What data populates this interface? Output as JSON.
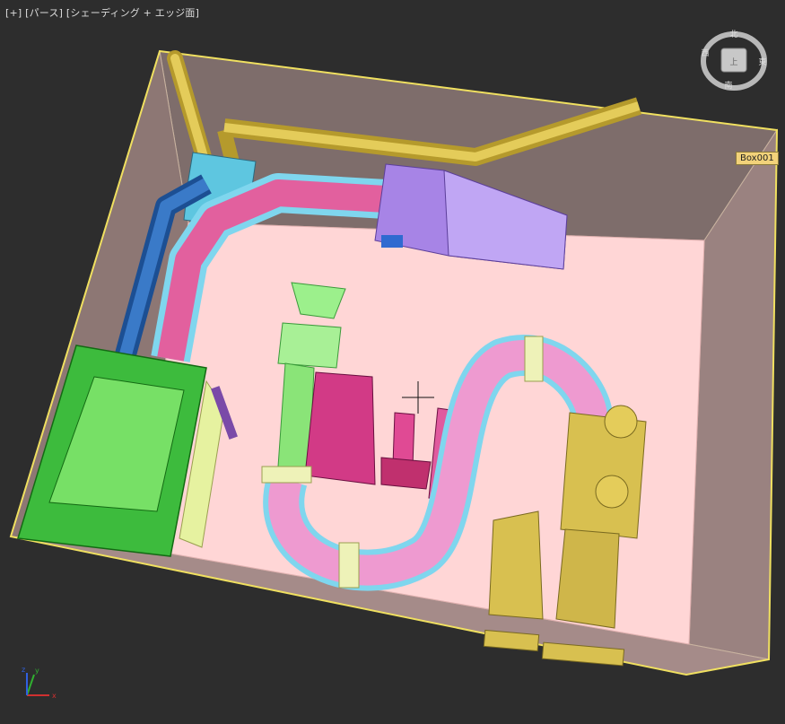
{
  "viewport": {
    "label_plus": "[+]",
    "label_view": "[パース]",
    "label_shading": "[シェーディング + エッジ面]"
  },
  "selected_object": {
    "name": "Box001"
  },
  "viewcube": {
    "north": "北",
    "east": "東",
    "south": "南",
    "west": "西",
    "top": "上"
  },
  "axis_gizmo": {
    "x": "x",
    "y": "y",
    "z": "z"
  },
  "colors": {
    "background": "#2d2d2d",
    "selection": "#f0e060",
    "floor": "#ffd8d8",
    "walls": "#8a7472",
    "green": "#66dd55",
    "pink": "#e066a8",
    "lavender": "#b28ff0",
    "gold": "#d8c050",
    "blue": "#3a7ac8",
    "cyan": "#66c8e0",
    "magenta": "#d0307a"
  }
}
